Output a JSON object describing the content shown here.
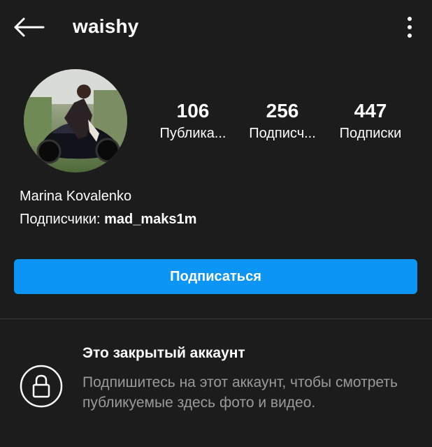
{
  "header": {
    "username": "waishy",
    "back_icon": "arrow-left-icon",
    "menu_icon": "more-vertical-icon"
  },
  "profile": {
    "avatar_description": "profile photo of rider on motorcycle",
    "stats": [
      {
        "value": "106",
        "label": "Публика..."
      },
      {
        "value": "256",
        "label": "Подписч..."
      },
      {
        "value": "447",
        "label": "Подписки"
      }
    ],
    "full_name": "Marina Kovalenko",
    "followers_prefix": "Подписчики:",
    "followers_user": "mad_maks1m"
  },
  "actions": {
    "follow_label": "Подписаться",
    "accent_color": "#0d95f6"
  },
  "private_notice": {
    "icon": "lock-icon",
    "title": "Это закрытый аккаунт",
    "description": "Подпишитесь на этот аккаунт, чтобы смотреть публикуемые здесь фото и видео."
  }
}
